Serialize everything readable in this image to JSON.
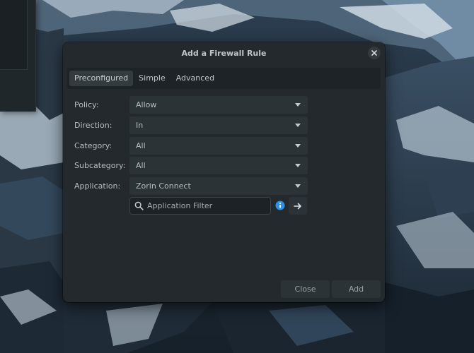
{
  "dialog": {
    "title": "Add a Firewall Rule"
  },
  "tabs": [
    {
      "label": "Preconfigured",
      "active": true
    },
    {
      "label": "Simple",
      "active": false
    },
    {
      "label": "Advanced",
      "active": false
    }
  ],
  "form": {
    "policy": {
      "label": "Policy:",
      "value": "Allow"
    },
    "direction": {
      "label": "Direction:",
      "value": "In"
    },
    "category": {
      "label": "Category:",
      "value": "All"
    },
    "subcategory": {
      "label": "Subcategory:",
      "value": "All"
    },
    "application": {
      "label": "Application:",
      "value": "Zorin Connect"
    },
    "filter": {
      "placeholder": "Application Filter",
      "value": ""
    }
  },
  "footer": {
    "close_label": "Close",
    "add_label": "Add"
  },
  "icons": {
    "close": "close-icon",
    "search": "search-icon",
    "info": "info-icon",
    "arrow": "arrow-right-icon",
    "dropdown": "chevron-down-icon"
  },
  "colors": {
    "dialog_bg": "#23292c",
    "info_accent": "#2f8fe0"
  }
}
